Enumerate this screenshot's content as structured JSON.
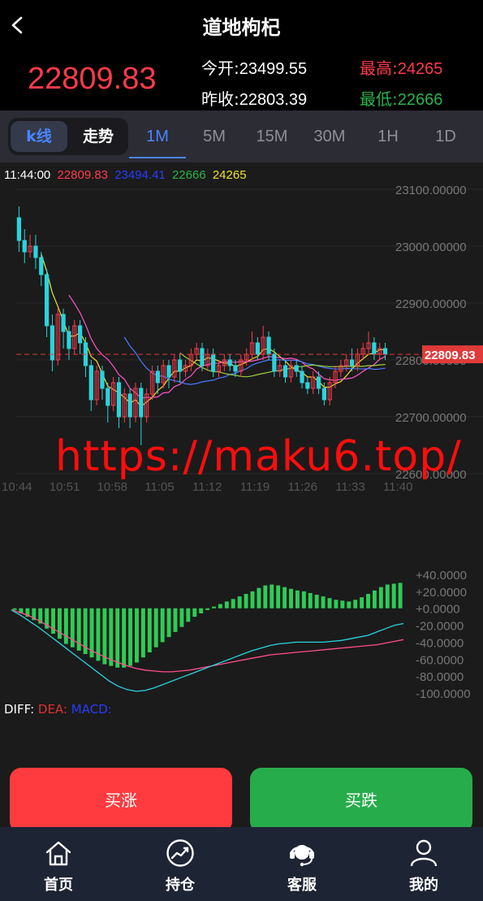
{
  "header": {
    "title": "道地枸杞",
    "price": "22809.83",
    "open_label": "今开:",
    "open_value": "23499.55",
    "prev_label": "昨收:",
    "prev_value": "22803.39",
    "high_label": "最高:",
    "high_value": "24265",
    "low_label": "最低:",
    "low_value": "22666"
  },
  "tabs": {
    "kline": "k线",
    "trend": "走势",
    "timeframes": [
      "1M",
      "5M",
      "15M",
      "30M",
      "1H",
      "1D"
    ],
    "active": "1M"
  },
  "info": {
    "time": "11:44:00",
    "v1": "22809.83",
    "v2": "23494.41",
    "v3": "22666",
    "v4": "24265",
    "c1": "#ff3b4b",
    "c2": "#2a3bff",
    "c3": "#2bb34a",
    "c4": "#f0e030"
  },
  "chart_data": [
    {
      "type": "candlestick",
      "title": "",
      "y_ticks": [
        "23100.00000",
        "23000.00000",
        "22900.00000",
        "22800.00000",
        "22700.00000",
        "22600.00000"
      ],
      "x_ticks": [
        "10:44",
        "10:51",
        "10:58",
        "11:05",
        "11:12",
        "11:19",
        "11:26",
        "11:33",
        "11:40"
      ],
      "ylim": [
        22600,
        23100
      ],
      "current_price": "22809.83",
      "current_price_color": "#e03a3a",
      "rise_color": "#ff3b4b",
      "fall_color": "#2ad4dc",
      "candles": [
        [
          23050,
          23010,
          23070,
          22990
        ],
        [
          23010,
          22990,
          23030,
          22970
        ],
        [
          22990,
          23000,
          23020,
          22980
        ],
        [
          23000,
          22980,
          23020,
          22960
        ],
        [
          22980,
          22950,
          22990,
          22930
        ],
        [
          22950,
          22860,
          22960,
          22840
        ],
        [
          22860,
          22800,
          22880,
          22780
        ],
        [
          22800,
          22880,
          22890,
          22790
        ],
        [
          22880,
          22850,
          22890,
          22820
        ],
        [
          22850,
          22820,
          22860,
          22800
        ],
        [
          22820,
          22860,
          22870,
          22810
        ],
        [
          22860,
          22830,
          22870,
          22810
        ],
        [
          22830,
          22790,
          22840,
          22770
        ],
        [
          22790,
          22730,
          22800,
          22710
        ],
        [
          22730,
          22780,
          22790,
          22720
        ],
        [
          22780,
          22750,
          22790,
          22730
        ],
        [
          22750,
          22720,
          22760,
          22690
        ],
        [
          22720,
          22760,
          22770,
          22710
        ],
        [
          22760,
          22700,
          22770,
          22680
        ],
        [
          22700,
          22740,
          22750,
          22690
        ],
        [
          22740,
          22700,
          22750,
          22680
        ],
        [
          22700,
          22750,
          22760,
          22690
        ],
        [
          22750,
          22700,
          22760,
          22650
        ],
        [
          22700,
          22740,
          22750,
          22690
        ],
        [
          22740,
          22780,
          22790,
          22730
        ],
        [
          22780,
          22760,
          22790,
          22740
        ],
        [
          22760,
          22790,
          22800,
          22750
        ],
        [
          22790,
          22770,
          22800,
          22750
        ],
        [
          22770,
          22800,
          22810,
          22760
        ],
        [
          22800,
          22780,
          22810,
          22760
        ],
        [
          22780,
          22790,
          22800,
          22770
        ],
        [
          22790,
          22810,
          22820,
          22780
        ],
        [
          22810,
          22820,
          22830,
          22800
        ],
        [
          22820,
          22790,
          22830,
          22780
        ],
        [
          22790,
          22810,
          22820,
          22780
        ],
        [
          22810,
          22780,
          22820,
          22770
        ],
        [
          22780,
          22790,
          22800,
          22770
        ],
        [
          22790,
          22800,
          22810,
          22780
        ],
        [
          22800,
          22790,
          22810,
          22780
        ],
        [
          22790,
          22780,
          22800,
          22770
        ],
        [
          22780,
          22800,
          22810,
          22770
        ],
        [
          22800,
          22810,
          22820,
          22790
        ],
        [
          22810,
          22830,
          22850,
          22800
        ],
        [
          22830,
          22810,
          22840,
          22800
        ],
        [
          22810,
          22840,
          22860,
          22800
        ],
        [
          22840,
          22810,
          22850,
          22800
        ],
        [
          22810,
          22780,
          22820,
          22770
        ],
        [
          22780,
          22790,
          22800,
          22770
        ],
        [
          22790,
          22770,
          22800,
          22760
        ],
        [
          22770,
          22790,
          22800,
          22760
        ],
        [
          22790,
          22780,
          22800,
          22770
        ],
        [
          22780,
          22760,
          22790,
          22750
        ],
        [
          22760,
          22750,
          22770,
          22740
        ],
        [
          22750,
          22770,
          22780,
          22740
        ],
        [
          22770,
          22750,
          22780,
          22740
        ],
        [
          22750,
          22730,
          22760,
          22720
        ],
        [
          22730,
          22760,
          22770,
          22720
        ],
        [
          22760,
          22780,
          22790,
          22750
        ],
        [
          22780,
          22790,
          22800,
          22770
        ],
        [
          22790,
          22800,
          22810,
          22780
        ],
        [
          22800,
          22790,
          22820,
          22780
        ],
        [
          22790,
          22810,
          22820,
          22780
        ],
        [
          22810,
          22820,
          22830,
          22800
        ],
        [
          22820,
          22830,
          22850,
          22810
        ],
        [
          22830,
          22810,
          22840,
          22800
        ],
        [
          22810,
          22820,
          22830,
          22800
        ],
        [
          22820,
          22810,
          22830,
          22800
        ]
      ],
      "ma_colors": [
        "#f0e030",
        "#ff55c8",
        "#4a7bff",
        "#9ad040"
      ]
    },
    {
      "type": "bar",
      "title": "MACD",
      "y_ticks": [
        "+40.0000",
        "+20.0000",
        "+0.0000",
        "-20.0000",
        "-40.0000",
        "-60.0000",
        "-80.0000",
        "-100.0000"
      ],
      "ylim": [
        -100,
        40
      ],
      "bar_color": "#2ecc57",
      "diff_color": "#2ad4dc",
      "dea_color": "#ff4d8d",
      "hist": [
        -2,
        -6,
        -10,
        -14,
        -18,
        -24,
        -30,
        -36,
        -42,
        -46,
        -50,
        -54,
        -58,
        -62,
        -66,
        -68,
        -70,
        -70,
        -68,
        -64,
        -58,
        -52,
        -46,
        -40,
        -34,
        -28,
        -22,
        -16,
        -10,
        -6,
        -2,
        2,
        5,
        8,
        11,
        14,
        17,
        20,
        24,
        27,
        28,
        27,
        25,
        23,
        21,
        20,
        18,
        16,
        14,
        12,
        10,
        9,
        8,
        10,
        13,
        17,
        21,
        25,
        28,
        29,
        30
      ],
      "diff": [
        -2,
        -8,
        -15,
        -22,
        -30,
        -38,
        -46,
        -54,
        -62,
        -70,
        -78,
        -86,
        -92,
        -96,
        -98,
        -97,
        -94,
        -90,
        -86,
        -82,
        -78,
        -74,
        -70,
        -66,
        -62,
        -58,
        -54,
        -50,
        -47,
        -44,
        -42,
        -41,
        -40,
        -40,
        -40,
        -40,
        -39,
        -38,
        -36,
        -34,
        -32,
        -28,
        -24,
        -20,
        -18
      ],
      "dea": [
        -2,
        -5,
        -9,
        -14,
        -20,
        -26,
        -32,
        -38,
        -44,
        -50,
        -55,
        -60,
        -64,
        -68,
        -71,
        -73,
        -74,
        -75,
        -75,
        -74,
        -73,
        -71,
        -69,
        -67,
        -65,
        -63,
        -61,
        -59,
        -57,
        -55,
        -54,
        -53,
        -52,
        -51,
        -50,
        -49,
        -48,
        -47,
        -46,
        -45,
        -44,
        -43,
        -41,
        -39,
        -37
      ]
    }
  ],
  "watermark": "https://maku6.top/",
  "macd_legend": {
    "diff": "DIFF:",
    "dea": "DEA:",
    "macd": "MACD:",
    "diff_color": "#ffffff",
    "dea_color": "#e03030",
    "macd_color": "#2a3bff"
  },
  "actions": {
    "buy": "买涨",
    "sell": "买跌"
  },
  "tabbar": {
    "items": [
      "首页",
      "持仓",
      "客服",
      "我的"
    ],
    "icons": [
      "home-icon",
      "chart-icon",
      "headset-icon",
      "user-icon"
    ]
  }
}
